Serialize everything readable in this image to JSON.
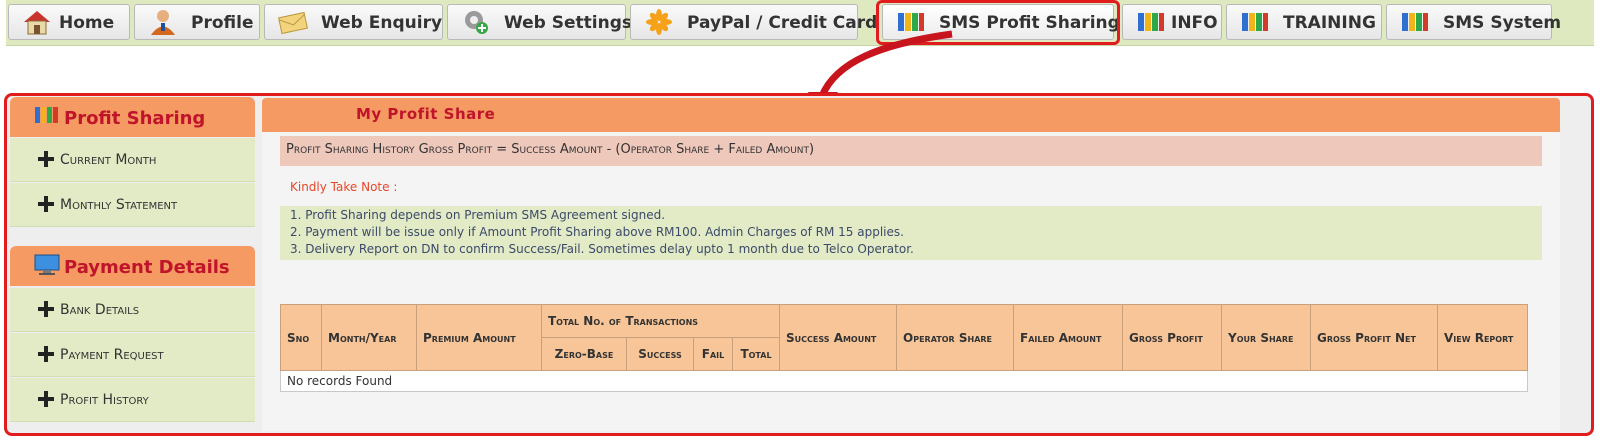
{
  "tabs": [
    {
      "label": "Home",
      "icon": "house-icon"
    },
    {
      "label": "Profile",
      "icon": "user-icon"
    },
    {
      "label": "Web Enquiry",
      "icon": "envelope-icon"
    },
    {
      "label": "Web Settings",
      "icon": "gear-icon"
    },
    {
      "label": "PayPal / Credit Card",
      "icon": "star-icon"
    },
    {
      "label": "SMS Profit Sharing",
      "icon": "folders-icon",
      "active": true
    },
    {
      "label": "INFO",
      "icon": "folders-icon"
    },
    {
      "label": "TRAINING",
      "icon": "folders-icon"
    },
    {
      "label": "SMS System",
      "icon": "folders-icon"
    }
  ],
  "sidebar": {
    "profit_sharing": {
      "title": "Profit Sharing",
      "items": [
        {
          "label": "Current Month"
        },
        {
          "label": "Monthly Statement"
        }
      ]
    },
    "payment_details": {
      "title": "Payment Details",
      "items": [
        {
          "label": "Bank Details"
        },
        {
          "label": "Payment Request"
        },
        {
          "label": "Profit History"
        }
      ]
    }
  },
  "main": {
    "title": "My Profit Share",
    "formula": "Profit Sharing History Gross Profit = Success Amount - (Operator Share + Failed Amount)",
    "note_title": "Kindly Take Note :",
    "notes": [
      "1. Profit Sharing depends on Premium SMS Agreement signed.",
      "2. Payment will be issue only if Amount Profit Sharing above RM100. Admin Charges of RM 15 applies.",
      "3. Delivery Report on DN to confirm Success/Fail. Sometimes delay upto 1 month due to Telco Operator."
    ],
    "table": {
      "columns": {
        "sno": "Sno",
        "month_year": "Month/Year",
        "premium_amount": "Premium Amount",
        "total_transactions": "Total No. of Transactions",
        "zero_base": "Zero-Base",
        "success": "Success",
        "fail": "Fail",
        "total": "Total",
        "success_amount": "Success Amount",
        "operator_share": "Operator Share",
        "failed_amount": "Failed Amount",
        "gross_profit": "Gross Profit",
        "your_share": "Your Share",
        "gross_profit_net": "Gross Profit Net",
        "view_report": "View Report"
      },
      "empty_message": "No records Found"
    }
  },
  "colors": {
    "accent_orange": "#f59a62",
    "heading_red": "#c0142b",
    "highlight_red": "#e01c1c",
    "sidebar_green": "#e2ebc6",
    "tab_bar_green": "#dfe9c0"
  }
}
